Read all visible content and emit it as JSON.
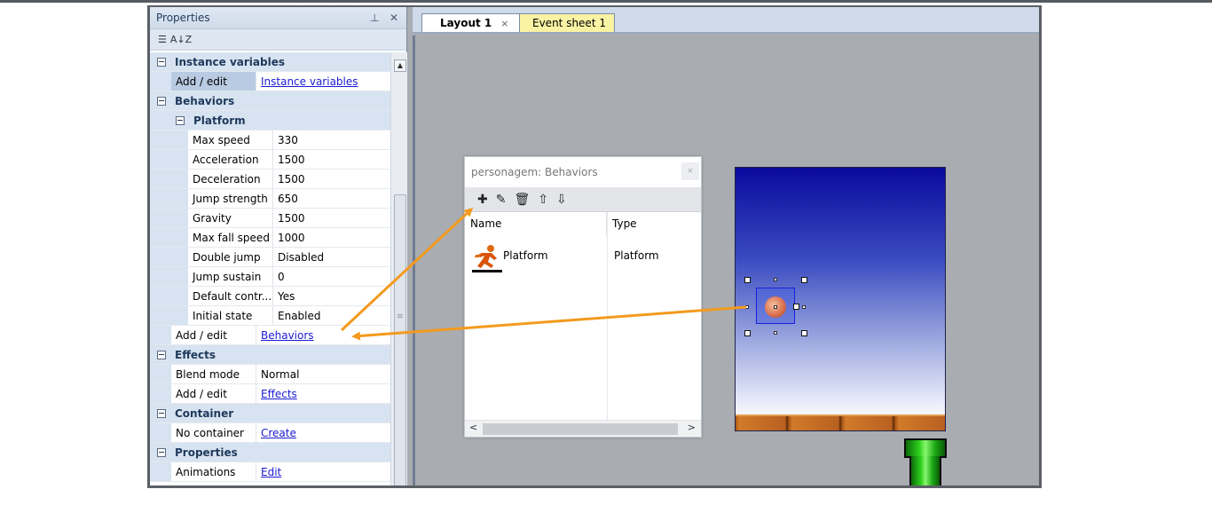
{
  "properties_panel": {
    "title": "Properties",
    "pin_icon": "pin-icon",
    "close_icon": "close-icon",
    "toolbar": {
      "categorized_icon": "categorized-icon",
      "sort_icon": "sort-az-icon",
      "sort_label": "A↓Z"
    },
    "sections": {
      "instance_variables": {
        "label": "Instance variables",
        "add_edit_label": "Add / edit",
        "add_edit_link": "Instance variables"
      },
      "behaviors": {
        "label": "Behaviors",
        "platform_label": "Platform",
        "items": [
          {
            "name": "Max speed",
            "value": "330"
          },
          {
            "name": "Acceleration",
            "value": "1500"
          },
          {
            "name": "Deceleration",
            "value": "1500"
          },
          {
            "name": "Jump strength",
            "value": "650"
          },
          {
            "name": "Gravity",
            "value": "1500"
          },
          {
            "name": "Max fall speed",
            "value": "1000"
          },
          {
            "name": "Double jump",
            "value": "Disabled"
          },
          {
            "name": "Jump sustain",
            "value": "0"
          },
          {
            "name": "Default contr...",
            "value": "Yes"
          },
          {
            "name": "Initial state",
            "value": "Enabled"
          }
        ],
        "add_edit_label": "Add / edit",
        "add_edit_link": "Behaviors"
      },
      "effects": {
        "label": "Effects",
        "blend_mode_label": "Blend mode",
        "blend_mode_value": "Normal",
        "add_edit_label": "Add / edit",
        "add_edit_link": "Effects"
      },
      "container": {
        "label": "Container",
        "no_container_label": "No container",
        "create_link": "Create"
      },
      "properties": {
        "label": "Properties",
        "animations_label": "Animations",
        "edit_link": "Edit"
      }
    }
  },
  "tabs": [
    {
      "label": "Layout 1",
      "active": true,
      "close": "×"
    },
    {
      "label": "Event sheet 1",
      "active": false
    }
  ],
  "behaviors_dialog": {
    "title": "personagem: Behaviors",
    "toolbar_icons": [
      "add-icon",
      "edit-pencil-icon",
      "delete-trash-icon",
      "move-up-icon",
      "move-down-icon"
    ],
    "columns": {
      "name": "Name",
      "type": "Type"
    },
    "rows": [
      {
        "name": "Platform",
        "type": "Platform",
        "icon": "platform-runner-icon"
      }
    ],
    "scroll_left": "<",
    "scroll_right": ">"
  },
  "colors": {
    "accent_arrow": "#f39a1e",
    "event_tab": "#fbf3a4",
    "link": "#1b1bd6",
    "category_bg": "#d7e3f1"
  }
}
